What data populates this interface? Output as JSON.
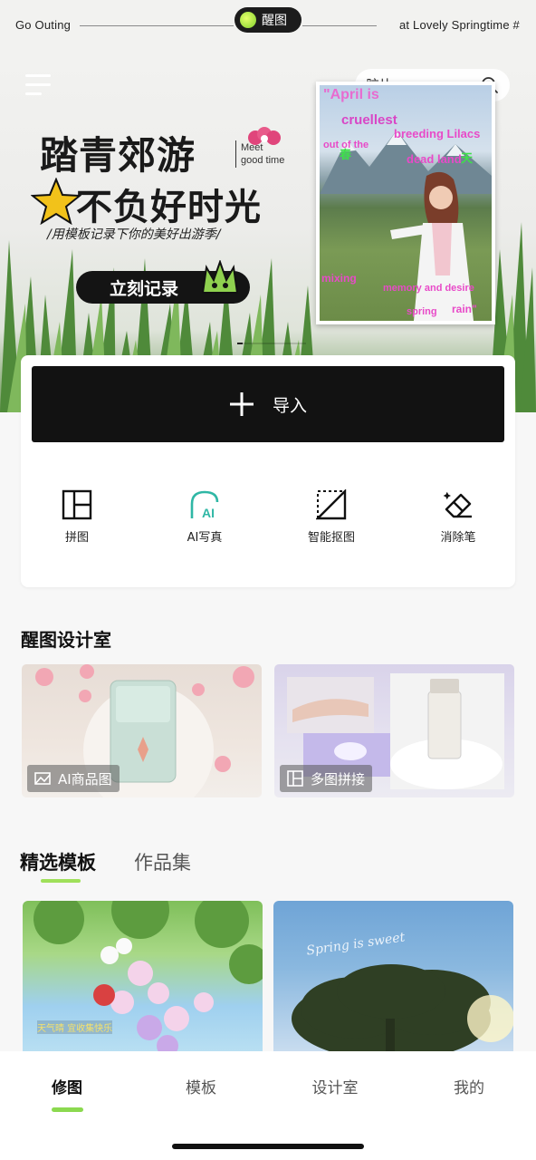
{
  "status_bar": {
    "left_text": "Go Outing",
    "right_text": "at Lovely Springtime #",
    "logo_text": "醒图"
  },
  "header": {
    "search_placeholder": "胶片"
  },
  "hero": {
    "title_line1": "踏青郊游",
    "title_line2": "不负好时光",
    "meet_line1": "Meet",
    "meet_line2": "good time",
    "subtitle": "/用模板记录下你的美好出游季/",
    "cta_label": "立刻记录",
    "photo_texts": [
      "\"April is",
      "cruellest",
      "breeding Lilacs",
      "out of the",
      "dead land",
      "春",
      "天",
      "mixing",
      "memory and desire",
      "spring",
      "rain\""
    ]
  },
  "tools": {
    "import_label": "导入",
    "items": [
      {
        "label": "拼图",
        "icon": "collage-icon"
      },
      {
        "label": "AI写真",
        "icon": "ai-portrait-icon"
      },
      {
        "label": "智能抠图",
        "icon": "smart-cutout-icon"
      },
      {
        "label": "消除笔",
        "icon": "eraser-icon"
      }
    ]
  },
  "studio": {
    "title": "醒图设计室",
    "cards": [
      {
        "label": "AI商品图",
        "icon": "ai-product-icon"
      },
      {
        "label": "多图拼接",
        "icon": "multi-collage-icon"
      }
    ]
  },
  "templates": {
    "tabs": [
      {
        "label": "精选模板",
        "active": true
      },
      {
        "label": "作品集",
        "active": false
      }
    ],
    "card1_caption": "天气晴 宜收集快乐",
    "card2_caption": "Spring is sweet"
  },
  "bottom_nav": {
    "items": [
      {
        "label": "修图",
        "active": true
      },
      {
        "label": "模板",
        "active": false
      },
      {
        "label": "设计室",
        "active": false
      },
      {
        "label": "我的",
        "active": false
      }
    ]
  },
  "colors": {
    "accent_green": "#9fe05a",
    "dark": "#121212"
  }
}
